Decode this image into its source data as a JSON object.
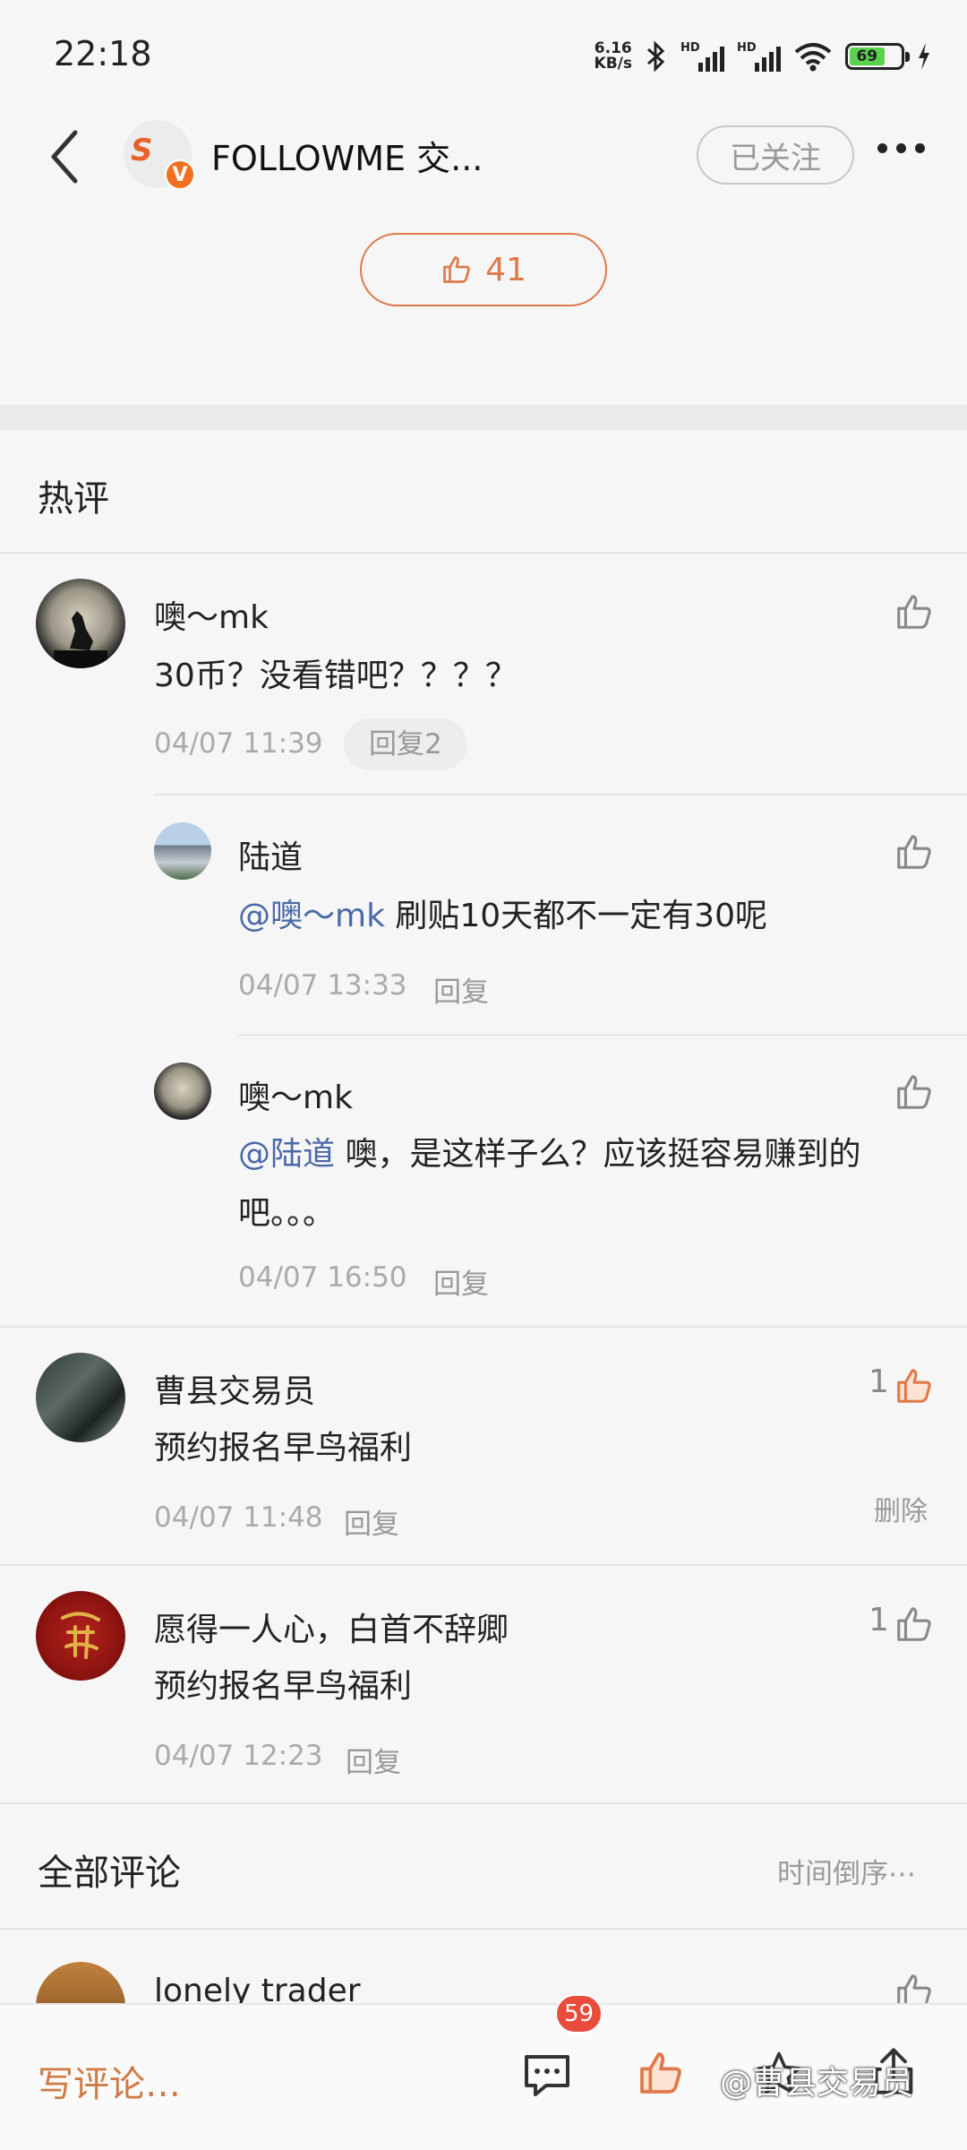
{
  "status_bar": {
    "time": "22:18",
    "net_speed_value": "6.16",
    "net_speed_unit": "KB/s",
    "sim1_label": "HD",
    "sim2_label": "HD",
    "battery": "69"
  },
  "header": {
    "title": "FOLLOWME 交...",
    "logo_text": "S",
    "logo_badge": "V",
    "follow_label": "已关注"
  },
  "post": {
    "like_count": "41"
  },
  "hot_section": {
    "title": "热评"
  },
  "hot_comments": [
    {
      "name": "噢～mk",
      "text": "30币？没看错吧？？？？",
      "time": "04/07 11:39",
      "reply_label": "回复2",
      "replies": [
        {
          "name": "陆道",
          "mention": "@噢～mk",
          "text": " 刷贴10天都不一定有30呢",
          "time": "04/07 13:33",
          "reply_label": "回复"
        },
        {
          "name": "噢～mk",
          "mention": "@陆道",
          "text": " 噢，是这样子么？应该挺容易赚到的吧。。。",
          "time": "04/07 16:50",
          "reply_label": "回复"
        }
      ]
    },
    {
      "name": "曹县交易员",
      "text": "预约报名早鸟福利",
      "time": "04/07 11:48",
      "reply_label": "回复",
      "likes": "1",
      "delete_label": "删除"
    },
    {
      "name": "愿得一人心，白首不辞卿",
      "text": "预约报名早鸟福利",
      "time": "04/07 12:23",
      "reply_label": "回复",
      "likes": "1"
    }
  ],
  "all_section": {
    "title": "全部评论",
    "sort_label": "时间倒序⋯"
  },
  "partial_comment": {
    "name": "lonely trader"
  },
  "bottom_bar": {
    "placeholder": "写评论…",
    "comment_badge": "59",
    "watermark": "@曹县交易员"
  },
  "colors": {
    "accent": "#e0794a",
    "mention": "#4a69a8",
    "badge": "#e94b3c"
  },
  "icons": [
    "back-arrow-icon",
    "thumb-up-icon",
    "comment-icon",
    "star-icon",
    "share-icon",
    "more-dots-icon"
  ]
}
